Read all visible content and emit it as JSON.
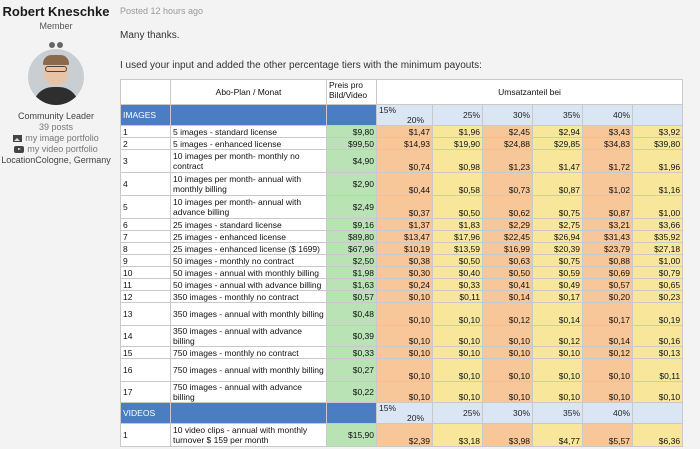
{
  "author": {
    "name": "Robert Kneschke",
    "role": "Member",
    "title": "Community Leader",
    "posts": "39 posts",
    "image_portfolio": "my image portfolio",
    "video_portfolio": "my video portfolio",
    "location": "LocationCologne, Germany"
  },
  "post": {
    "posted": "Posted 12 hours ago",
    "line1": "Many thanks.",
    "line2": "I used your input and added the other percentage tiers with the minimum payouts:"
  },
  "table": {
    "headers": {
      "plan": "Abo-Plan / Monat",
      "price": "Preis pro Bild/Video",
      "share": "Umsatzanteil bei"
    },
    "images_label": "IMAGES",
    "videos_label": "VIDEOS",
    "tiers": [
      "15%",
      "20%",
      "25%",
      "30%",
      "35%",
      "40%"
    ],
    "images": [
      {
        "n": "1",
        "desc": "5 images - standard license",
        "price": "$9,80",
        "v": [
          "$1,47",
          "$1,96",
          "$2,45",
          "$2,94",
          "$3,43",
          "$3,92"
        ]
      },
      {
        "n": "2",
        "desc": "5 images - enhanced license",
        "price": "$99,50",
        "v": [
          "$14,93",
          "$19,90",
          "$24,88",
          "$29,85",
          "$34,83",
          "$39,80"
        ]
      },
      {
        "n": "3",
        "desc": "10 images per month- monthly no contract",
        "price": "$4,90",
        "v": [
          "$0,74",
          "$0,98",
          "$1,23",
          "$1,47",
          "$1,72",
          "$1,96"
        ]
      },
      {
        "n": "4",
        "desc": "10 images per month- annual with monthly billing",
        "price": "$2,90",
        "v": [
          "$0,44",
          "$0,58",
          "$0,73",
          "$0,87",
          "$1,02",
          "$1,16"
        ]
      },
      {
        "n": "5",
        "desc": "10 images per month- annual with advance billing",
        "price": "$2,49",
        "v": [
          "$0,37",
          "$0,50",
          "$0,62",
          "$0,75",
          "$0,87",
          "$1,00"
        ]
      },
      {
        "n": "6",
        "desc": "25 images - standard license",
        "price": "$9,16",
        "v": [
          "$1,37",
          "$1,83",
          "$2,29",
          "$2,75",
          "$3,21",
          "$3,66"
        ]
      },
      {
        "n": "7",
        "desc": "25 images - enhanced license",
        "price": "$89,80",
        "v": [
          "$13,47",
          "$17,96",
          "$22,45",
          "$26,94",
          "$31,43",
          "$35,92"
        ]
      },
      {
        "n": "8",
        "desc": "25 images - enhanced license ($ 1699)",
        "price": "$67,96",
        "v": [
          "$10,19",
          "$13,59",
          "$16,99",
          "$20,39",
          "$23,79",
          "$27,18"
        ]
      },
      {
        "n": "9",
        "desc": "50 images - monthly no contract",
        "price": "$2,50",
        "v": [
          "$0,38",
          "$0,50",
          "$0,63",
          "$0,75",
          "$0,88",
          "$1,00"
        ]
      },
      {
        "n": "10",
        "desc": "50 images - annual with monthly billing",
        "price": "$1,98",
        "v": [
          "$0,30",
          "$0,40",
          "$0,50",
          "$0,59",
          "$0,69",
          "$0,79"
        ]
      },
      {
        "n": "11",
        "desc": "50 images - annual with advance billing",
        "price": "$1,63",
        "v": [
          "$0,24",
          "$0,33",
          "$0,41",
          "$0,49",
          "$0,57",
          "$0,65"
        ]
      },
      {
        "n": "12",
        "desc": "350 images - monthly no contract",
        "price": "$0,57",
        "v": [
          "$0,10",
          "$0,11",
          "$0,14",
          "$0,17",
          "$0,20",
          "$0,23"
        ]
      },
      {
        "n": "13",
        "desc": "350 images - annual with monthly billing",
        "price": "$0,48",
        "v": [
          "$0,10",
          "$0,10",
          "$0,12",
          "$0,14",
          "$0,17",
          "$0,19"
        ]
      },
      {
        "n": "14",
        "desc": "350 images - annual with advance billing",
        "price": "$0,39",
        "v": [
          "$0,10",
          "$0,10",
          "$0,10",
          "$0,12",
          "$0,14",
          "$0,16"
        ]
      },
      {
        "n": "15",
        "desc": "750 images - monthly no contract",
        "price": "$0,33",
        "v": [
          "$0,10",
          "$0,10",
          "$0,10",
          "$0,10",
          "$0,12",
          "$0,13"
        ]
      },
      {
        "n": "16",
        "desc": "750 images - annual with monthly billing",
        "price": "$0,27",
        "v": [
          "$0,10",
          "$0,10",
          "$0,10",
          "$0,10",
          "$0,10",
          "$0,11"
        ]
      },
      {
        "n": "17",
        "desc": "750 images - annual with advance billing",
        "price": "$0,22",
        "v": [
          "$0,10",
          "$0,10",
          "$0,10",
          "$0,10",
          "$0,10",
          "$0,10"
        ]
      }
    ],
    "videos": [
      {
        "n": "1",
        "desc": "10 video clips - annual with monthly turnover $ 159 per month",
        "price": "$15,90",
        "v": [
          "$2,39",
          "$3,18",
          "$3,98",
          "$4,77",
          "$5,57",
          "$6,36"
        ]
      }
    ]
  }
}
